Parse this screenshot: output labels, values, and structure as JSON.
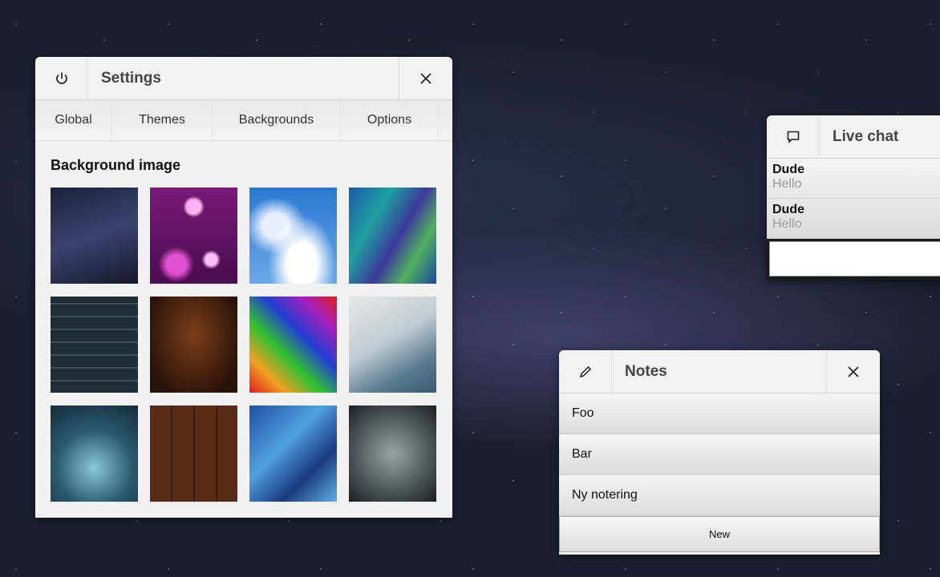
{
  "settings": {
    "title": "Settings",
    "tabs": [
      "Global",
      "Themes",
      "Backgrounds",
      "Options"
    ],
    "section_title": "Background image",
    "thumbnails": [
      "night-sky",
      "pink-bokeh",
      "blue-sky-clouds",
      "abstract-paint",
      "dark-stone-wall",
      "dark-wood",
      "psychedelic-swirl",
      "curved-surface",
      "water-drops",
      "brown-wood",
      "blue-paint",
      "grunge-concrete"
    ]
  },
  "chat": {
    "title": "Live chat",
    "messages": [
      {
        "author": "Dude",
        "text": "Hello"
      },
      {
        "author": "Dude",
        "text": "Hello"
      }
    ],
    "input_value": ""
  },
  "notes": {
    "title": "Notes",
    "items": [
      "Foo",
      "Bar",
      "Ny notering"
    ],
    "new_label": "New"
  }
}
